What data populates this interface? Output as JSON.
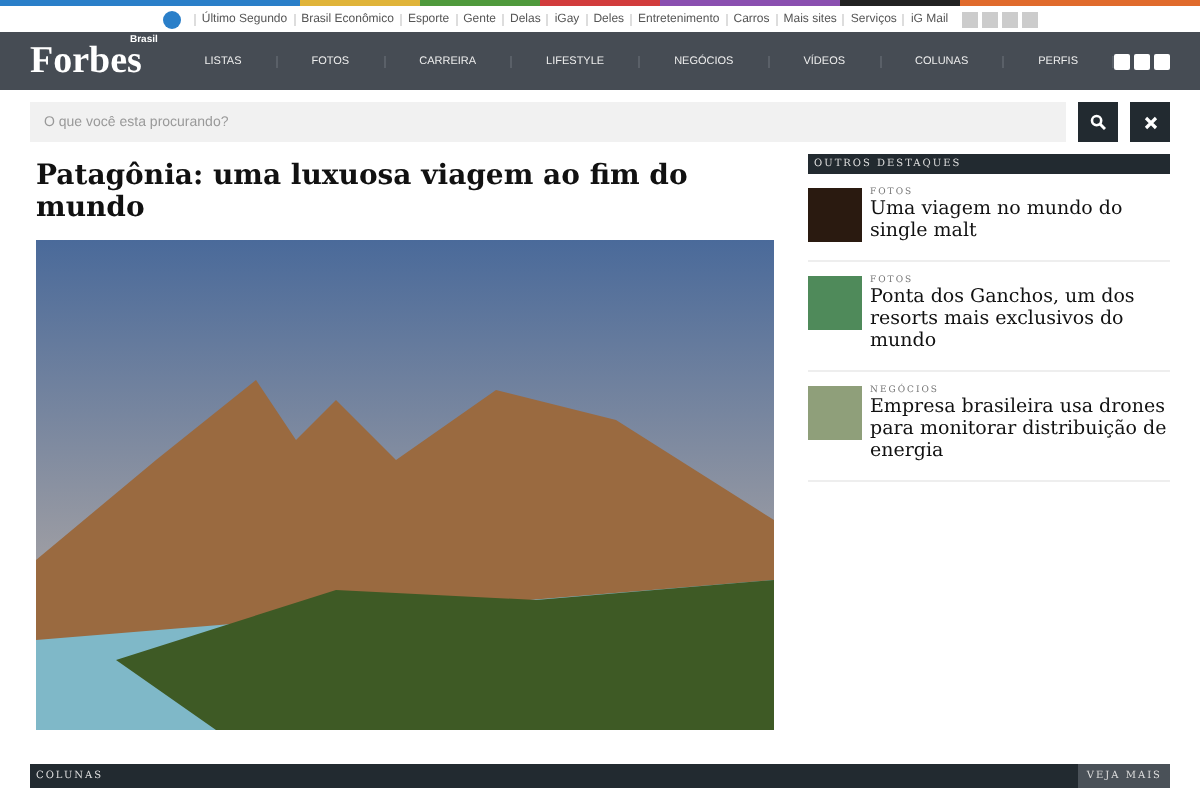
{
  "top_links": [
    "Último Segundo",
    "Brasil Econômico",
    "Esporte",
    "Gente",
    "Delas",
    "iGay",
    "Deles",
    "Entretenimento",
    "Carros",
    "Mais sites",
    "Serviços",
    "iG Mail"
  ],
  "logo": {
    "name": "Forbes",
    "edition": "Brasil"
  },
  "nav": [
    "LISTAS",
    "FOTOS",
    "CARREIRA",
    "LIFESTYLE",
    "NEGÓCIOS",
    "VÍDEOS",
    "COLUNAS",
    "PERFIS"
  ],
  "search": {
    "placeholder": "O que você esta procurando?"
  },
  "article": {
    "title": "Patagônia: uma luxuosa viagem ao fim do mundo"
  },
  "sidebar": {
    "title": "OUTROS DESTAQUES",
    "items": [
      {
        "category": "FOTOS",
        "headline": "Uma viagem no mundo do single malt"
      },
      {
        "category": "FOTOS",
        "headline": "Ponta dos Ganchos, um dos resorts mais exclusivos do mundo"
      },
      {
        "category": "NEGÓCIOS",
        "headline": "Empresa brasileira usa drones para monitorar distribuição de energia"
      }
    ]
  },
  "columns_bar": {
    "title": "COLUNAS",
    "more": "VEJA MAIS"
  }
}
